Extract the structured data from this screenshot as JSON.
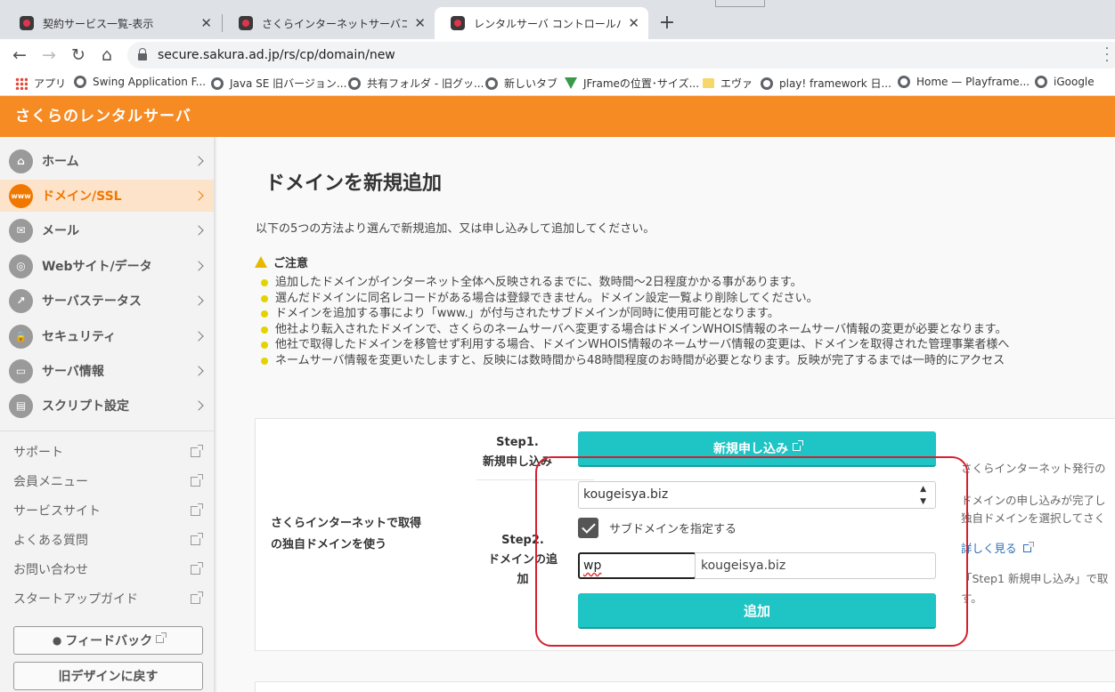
{
  "browser": {
    "tabs": [
      {
        "title": "契約サービス一覧-表示",
        "close": "✕"
      },
      {
        "title": "さくらインターネットサーバコントロールパネル",
        "close": "✕"
      },
      {
        "title": "レンタルサーバ コントロールパネル",
        "close": "✕"
      }
    ],
    "new_tab": "+",
    "url": "secure.sakura.ad.jp/rs/cp/domain/new",
    "nav": {
      "back": "←",
      "forward": "→",
      "reload": "↻",
      "home": "⌂"
    },
    "bookmarks": [
      {
        "label": "アプリ",
        "icon": "apps-grid-icon"
      },
      {
        "label": "Swing Application F...",
        "icon": "globe-icon"
      },
      {
        "label": "Java SE 旧バージョン...",
        "icon": "globe-icon"
      },
      {
        "label": "共有フォルダ - 旧グッ...",
        "icon": "globe-icon"
      },
      {
        "label": "新しいタブ",
        "icon": "globe-icon"
      },
      {
        "label": "JFrameの位置･サイズ...",
        "icon": "triangle-icon"
      },
      {
        "label": "エヴァ",
        "icon": "folder-icon"
      },
      {
        "label": "play! framework 日...",
        "icon": "globe-icon"
      },
      {
        "label": "Home — Playframe...",
        "icon": "globe-icon"
      },
      {
        "label": "iGoogle",
        "icon": "globe-icon"
      }
    ]
  },
  "app": {
    "title": "さくらのレンタルサーバ",
    "brand_color": "#f68b23"
  },
  "sidebar": {
    "items": [
      {
        "label": "ホーム",
        "icon": "home-icon",
        "glyph": "⌂"
      },
      {
        "label": "ドメイン/SSL",
        "icon": "www-lock-icon",
        "glyph": "www",
        "active": true
      },
      {
        "label": "メール",
        "icon": "mail-icon",
        "glyph": "✉"
      },
      {
        "label": "Webサイト/データ",
        "icon": "globe-icon",
        "glyph": "◎"
      },
      {
        "label": "サーバステータス",
        "icon": "chart-icon",
        "glyph": "↗"
      },
      {
        "label": "セキュリティ",
        "icon": "lock-icon",
        "glyph": "🔒"
      },
      {
        "label": "サーバ情報",
        "icon": "server-icon",
        "glyph": "▭"
      },
      {
        "label": "スクリプト設定",
        "icon": "script-icon",
        "glyph": "▤"
      }
    ],
    "links": [
      "サポート",
      "会員メニュー",
      "サービスサイト",
      "よくある質問",
      "お問い合わせ",
      "スタートアップガイド"
    ],
    "feedback": "フィードバック",
    "old_design": "旧デザインに戻す"
  },
  "main": {
    "title": "ドメインを新規追加",
    "intro": "以下の5つの方法より選んで新規追加、又は申し込みして追加してください。",
    "caution_title": "ご注意",
    "cautions": [
      "追加したドメインがインターネット全体へ反映されるまでに、数時間～2日程度かかる事があります。",
      "選んだドメインに同名レコードがある場合は登録できません。ドメイン設定一覧より削除してください。",
      "ドメインを追加する事により「www.」が付与されたサブドメインが同時に使用可能となります。",
      "他社より転入されたドメインで、さくらのネームサーバへ変更する場合はドメインWHOIS情報のネームサーバ情報の変更が必要となります。",
      "他社で取得したドメインを移管せず利用する場合、ドメインWHOIS情報のネームサーバ情報の変更は、ドメインを取得された管理事業者様へ",
      "ネームサーバ情報を変更いたしますと、反映には数時間から48時間程度のお時間が必要となります。反映が完了するまでは一時的にアクセス"
    ],
    "card": {
      "label_line1": "さくらインターネットで取得",
      "label_line2": "の独自ドメインを使う",
      "step1_line1": "Step1.",
      "step1_line2": "新規申し込み",
      "apply_button": "新規申し込み",
      "step2_line1": "Step2.",
      "step2_line2": "ドメインの追",
      "step2_line3": "加",
      "domain_select": "kougeisya.biz",
      "subdomain_checkbox_label": "サブドメインを指定する",
      "subdomain_checked": true,
      "subdomain_value": "wp",
      "domain_suffix": "kougeisya.biz",
      "add_button": "追加",
      "notes": [
        "さくらインターネット発行の",
        "ドメインの申し込みが完了し",
        "独自ドメインを選択してさく",
        "詳しく見る",
        "「Step1 新規申し込み」で取",
        "す。"
      ]
    }
  }
}
